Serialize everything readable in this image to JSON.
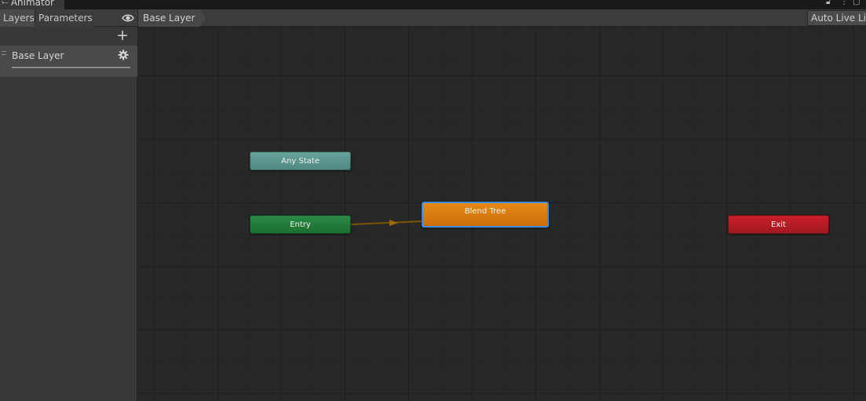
{
  "window": {
    "title": "Animator",
    "title_icon": "animator-icon"
  },
  "left_panel": {
    "tabs": [
      {
        "label": "Layers"
      },
      {
        "label": "Parameters"
      }
    ],
    "layers": [
      {
        "name": "Base Layer"
      }
    ]
  },
  "toolbar": {
    "breadcrumb": "Base Layer",
    "auto_live_link": "Auto Live Link"
  },
  "graph": {
    "nodes": {
      "any_state": "Any State",
      "entry": "Entry",
      "blend_tree": "Blend Tree",
      "exit": "Exit"
    }
  },
  "colors": {
    "any_state": "#5c978f",
    "entry": "#237d3b",
    "blend_tree": "#d87d0f",
    "exit": "#b81c25",
    "selection": "#3c8cdb",
    "transition": "#8a5a06"
  }
}
